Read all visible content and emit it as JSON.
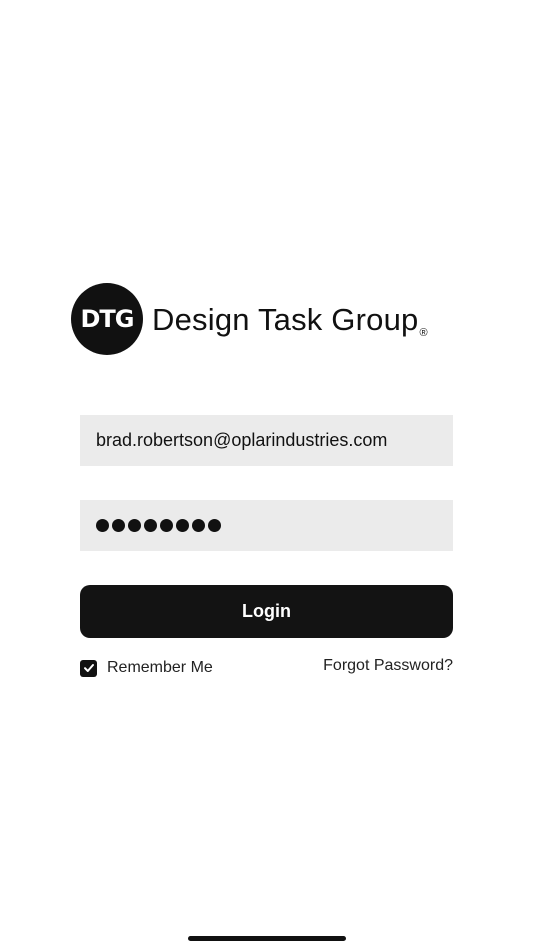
{
  "brand": {
    "mark_text": "DTG",
    "name": "Design Task Group",
    "registered_symbol": "®"
  },
  "login_form": {
    "email_value": "brad.robertson@oplarindustries.com",
    "password_mask_count": 8,
    "login_label": "Login",
    "remember_me_label": "Remember Me",
    "remember_me_checked": true,
    "forgot_password_label": "Forgot Password?"
  },
  "colors": {
    "primary": "#131313",
    "field_background": "#ebebeb",
    "background": "#ffffff"
  }
}
